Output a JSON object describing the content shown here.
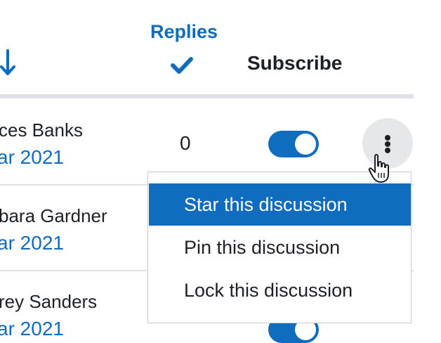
{
  "header": {
    "replies_label": "Replies",
    "subscribe_label": "Subscribe"
  },
  "rows": [
    {
      "author": "ces Banks",
      "date": "ar 2021",
      "replies": "0",
      "subscribed": true
    },
    {
      "author": "bara Gardner",
      "date": "ar 2021"
    },
    {
      "author": "rey Sanders",
      "date": "ar 2021",
      "subscribed": true
    }
  ],
  "menu": {
    "items": [
      {
        "label": "Star this discussion",
        "active": true
      },
      {
        "label": "Pin this discussion",
        "active": false
      },
      {
        "label": "Lock this discussion",
        "active": false
      }
    ]
  },
  "colors": {
    "accent": "#0f6cbf",
    "text": "#1d2125",
    "divider": "#dee2e6",
    "kebab_bg": "#e6e7e8"
  },
  "icons": [
    "sort-down-arrow-icon",
    "checkmark-icon",
    "kebab-menu-icon",
    "hand-pointer-cursor-icon"
  ]
}
